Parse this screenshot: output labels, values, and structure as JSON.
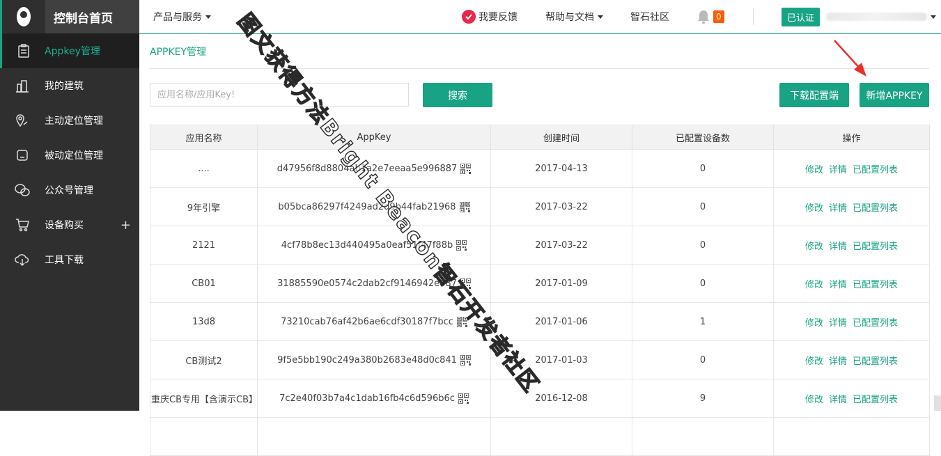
{
  "sidebar": {
    "title": "控制台首页",
    "items": [
      {
        "label": "Appkey管理",
        "icon": "clipboard-icon",
        "active": true
      },
      {
        "label": "我的建筑",
        "icon": "building-icon"
      },
      {
        "label": "主动定位管理",
        "icon": "location-icon"
      },
      {
        "label": "被动定位管理",
        "icon": "device-icon"
      },
      {
        "label": "公众号管理",
        "icon": "wechat-icon"
      },
      {
        "label": "设备购买",
        "icon": "cart-icon",
        "expand": "+"
      },
      {
        "label": "工具下载",
        "icon": "cloud-download-icon"
      }
    ]
  },
  "topbar": {
    "products": "产品与服务",
    "feedback": "我要反馈",
    "help": "帮助与文档",
    "community": "智石社区",
    "notification_count": "0",
    "verified": "已认证"
  },
  "breadcrumb": "APPKEY管理",
  "search": {
    "placeholder": "应用名称/应用Key!",
    "button": "搜索"
  },
  "actions": {
    "download": "下载配置端",
    "add": "新增APPKEY"
  },
  "table": {
    "headers": [
      "应用名称",
      "AppKey",
      "创建时间",
      "已配置设备数",
      "操作"
    ],
    "op_labels": [
      "修改",
      "详情",
      "已配置列表"
    ],
    "rows": [
      {
        "name": "....",
        "key": "d47956f8d8804ab1a2e7eeaa5e996887",
        "date": "2017-04-13",
        "count": "0"
      },
      {
        "name": "9年引擎",
        "key": "b05bca86297f4249ad2d9b44fab21968",
        "date": "2017-03-22",
        "count": "0"
      },
      {
        "name": "2121",
        "key": "4cf78b8ec13d440495a0eaf51f47f88b",
        "date": "2017-03-22",
        "count": "0"
      },
      {
        "name": "CB01",
        "key": "31885590e0574c2dab2cf9146942e687",
        "date": "2017-01-09",
        "count": "0"
      },
      {
        "name": "13d8",
        "key": "73210cab76af42b6ae6cdf30187f7bcc",
        "date": "2017-01-06",
        "count": "1"
      },
      {
        "name": "CB测试2",
        "key": "9f5e5bb190c249a380b2683e48d0c841",
        "date": "2017-01-03",
        "count": "0"
      },
      {
        "name": "重庆CB专用【含演示CB】",
        "key": "7c2e40f03b7a4c1dab16fb4c6d596b6c",
        "date": "2016-12-08",
        "count": "9"
      }
    ]
  },
  "watermark": "图文获得方法Bright Beacon智石开发者社区",
  "colors": {
    "accent": "#19a385",
    "sidebar_bg": "#2f2f2f",
    "badge": "#ff5a00",
    "arrow": "#e8312a"
  }
}
